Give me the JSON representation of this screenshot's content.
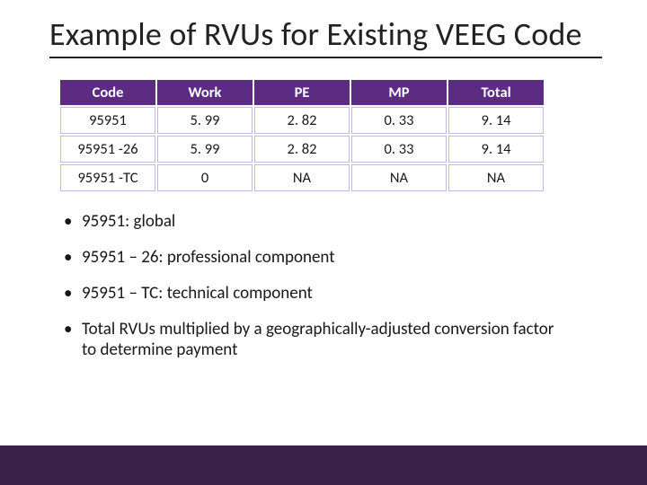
{
  "title": "Example of RVUs for Existing VEEG Code",
  "chart_data": {
    "type": "table",
    "columns": [
      "Code",
      "Work",
      "PE",
      "MP",
      "Total"
    ],
    "rows": [
      {
        "Code": "95951",
        "Work": "5. 99",
        "PE": "2. 82",
        "MP": "0. 33",
        "Total": "9. 14"
      },
      {
        "Code": "95951 -26",
        "Work": "5. 99",
        "PE": "2. 82",
        "MP": "0. 33",
        "Total": "9. 14"
      },
      {
        "Code": "95951 -TC",
        "Work": "0",
        "PE": "NA",
        "MP": "NA",
        "Total": "NA"
      }
    ]
  },
  "bullets": [
    "95951: global",
    "95951 – 26: professional component",
    "95951 – TC: technical component",
    "Total RVUs multiplied by a geographically-adjusted conversion factor to determine payment"
  ]
}
